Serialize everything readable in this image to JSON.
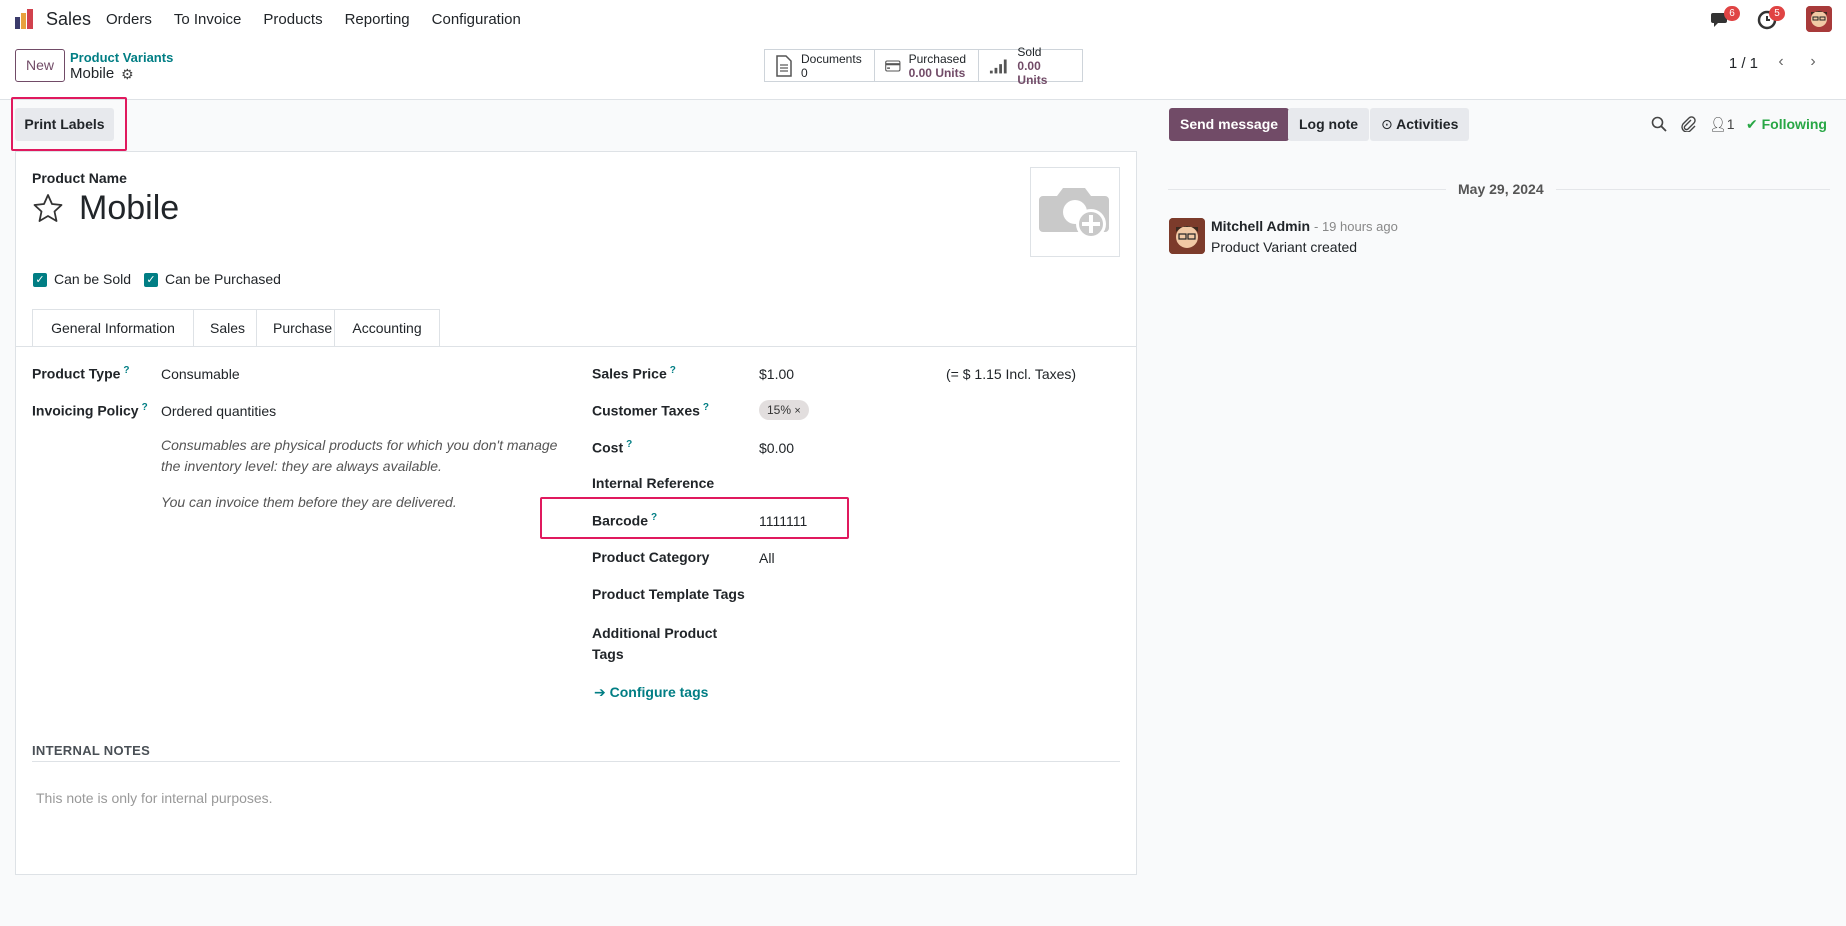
{
  "topbar": {
    "app_name": "Sales",
    "menu": [
      "Orders",
      "To Invoice",
      "Products",
      "Reporting",
      "Configuration"
    ],
    "messages_badge": "6",
    "activities_badge": "5"
  },
  "control": {
    "new_label": "New",
    "breadcrumb_parent": "Product Variants",
    "breadcrumb_current": "Mobile",
    "smart_buttons": [
      {
        "label": "Documents",
        "value": "0"
      },
      {
        "label": "Purchased",
        "value": "0.00 Units"
      },
      {
        "label": "Sold",
        "value": "0.00 Units"
      }
    ],
    "pager": "1 / 1"
  },
  "actions": {
    "print_labels": "Print Labels"
  },
  "form": {
    "product_name_label": "Product Name",
    "product_name": "Mobile",
    "can_be_sold": "Can be Sold",
    "can_be_purchased": "Can be Purchased",
    "tabs": [
      "General Information",
      "Sales",
      "Purchase",
      "Accounting"
    ],
    "product_type_label": "Product Type",
    "product_type": "Consumable",
    "invoicing_policy_label": "Invoicing Policy",
    "invoicing_policy": "Ordered quantities",
    "hint1_line1": "Consumables are physical products for which you don't manage",
    "hint1_line2": "the inventory level: they are always available.",
    "hint2": "You can invoice them before they are delivered.",
    "sales_price_label": "Sales Price",
    "sales_price": "$1.00",
    "sales_price_incl": "(= $ 1.15 Incl. Taxes)",
    "customer_taxes_label": "Customer Taxes",
    "customer_tax_tag": "15%",
    "cost_label": "Cost",
    "cost": "$0.00",
    "internal_reference_label": "Internal Reference",
    "barcode_label": "Barcode",
    "barcode": "1111111",
    "product_category_label": "Product Category",
    "product_category": "All",
    "template_tags_label": "Product Template Tags",
    "additional_tags_label_1": "Additional Product",
    "additional_tags_label_2": "Tags",
    "configure_tags": "Configure tags",
    "internal_notes_title": "INTERNAL NOTES",
    "internal_notes_placeholder": "This note is only for internal purposes."
  },
  "chatter": {
    "send_message": "Send message",
    "log_note": "Log note",
    "activities": "Activities",
    "followers_count": "1",
    "following": "Following",
    "date": "May 29, 2024",
    "author": "Mitchell Admin",
    "time": "- 19 hours ago",
    "message": "Product Variant created"
  },
  "colors": {
    "primary": "#714b67",
    "accent": "#017e84",
    "highlight": "#e0195e",
    "following": "#28a745"
  }
}
